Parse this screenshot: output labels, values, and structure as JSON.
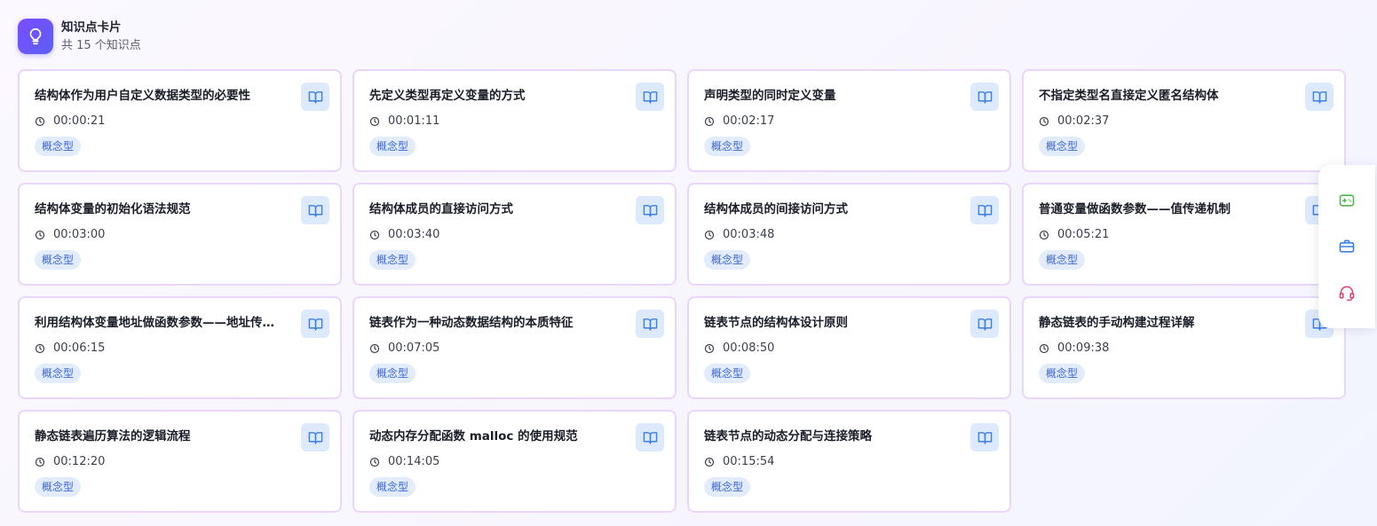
{
  "header": {
    "title": "知识点卡片",
    "subtitle": "共 15 个知识点",
    "icon": "lightbulb-icon"
  },
  "colors": {
    "accent_purple": "#6e55fb",
    "card_border": "#e9d6fb",
    "tag_bg": "#e2ecfd",
    "tag_text": "#3a66d6",
    "button_bg": "#ddeafd",
    "button_icon": "#3a7fe6"
  },
  "cards": [
    {
      "title": "结构体作为用户自定义数据类型的必要性",
      "time": "00:00:21",
      "tag": "概念型"
    },
    {
      "title": "先定义类型再定义变量的方式",
      "time": "00:01:11",
      "tag": "概念型"
    },
    {
      "title": "声明类型的同时定义变量",
      "time": "00:02:17",
      "tag": "概念型"
    },
    {
      "title": "不指定类型名直接定义匿名结构体",
      "time": "00:02:37",
      "tag": "概念型"
    },
    {
      "title": "结构体变量的初始化语法规范",
      "time": "00:03:00",
      "tag": "概念型"
    },
    {
      "title": "结构体成员的直接访问方式",
      "time": "00:03:40",
      "tag": "概念型"
    },
    {
      "title": "结构体成员的间接访问方式",
      "time": "00:03:48",
      "tag": "概念型"
    },
    {
      "title": "普通变量做函数参数——值传递机制",
      "time": "00:05:21",
      "tag": "概念型"
    },
    {
      "title": "利用结构体变量地址做函数参数——地址传递机制",
      "time": "00:06:15",
      "tag": "概念型"
    },
    {
      "title": "链表作为一种动态数据结构的本质特征",
      "time": "00:07:05",
      "tag": "概念型"
    },
    {
      "title": "链表节点的结构体设计原则",
      "time": "00:08:50",
      "tag": "概念型"
    },
    {
      "title": "静态链表的手动构建过程详解",
      "time": "00:09:38",
      "tag": "概念型"
    },
    {
      "title": "静态链表遍历算法的逻辑流程",
      "time": "00:12:20",
      "tag": "概念型"
    },
    {
      "title": "动态内存分配函数 malloc 的使用规范",
      "time": "00:14:05",
      "tag": "概念型"
    },
    {
      "title": "链表节点的动态分配与连接策略",
      "time": "00:15:54",
      "tag": "概念型"
    }
  ],
  "side_panel": [
    {
      "icon": "game-controller-icon",
      "color": "#4cb84a"
    },
    {
      "icon": "briefcase-icon",
      "color": "#3a7fe6"
    },
    {
      "icon": "headset-icon",
      "color": "#e0457b"
    }
  ]
}
